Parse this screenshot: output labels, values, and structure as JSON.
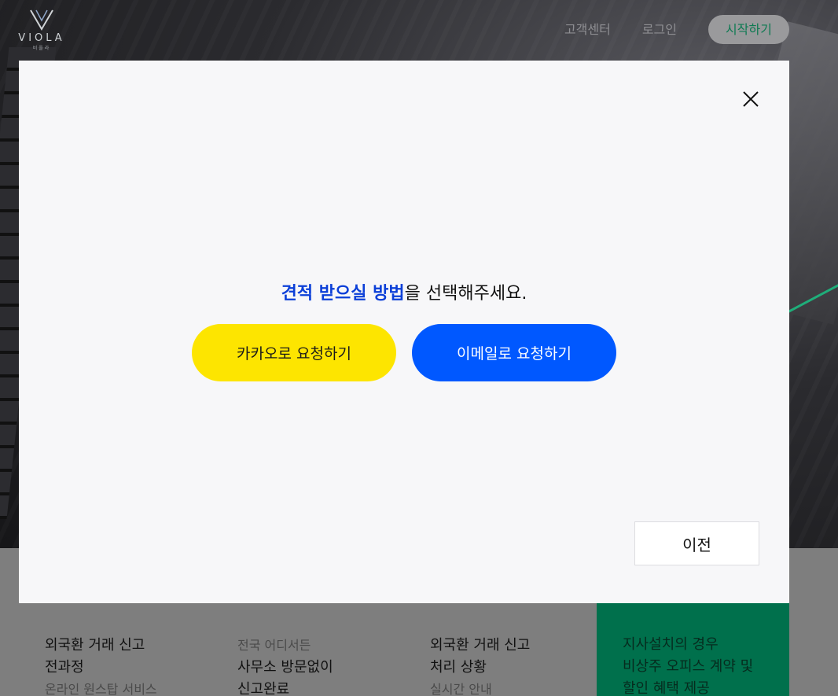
{
  "header": {
    "logo_text": "VIOLA",
    "logo_sub": "비올라",
    "nav": {
      "support": "고객센터",
      "login": "로그인",
      "start": "시작하기"
    }
  },
  "features": [
    {
      "line1": "외국환 거래 신고",
      "line2": "전과정",
      "sub": "온라인 원스탑 서비스"
    },
    {
      "sub_top": "전국 어디서든",
      "line1": "사무소 방문없이",
      "line2": "신고완료"
    },
    {
      "line1": "외국환 거래 신고",
      "line2": "처리 상황",
      "sub": "실시간 안내"
    },
    {
      "line1": "지사설치의 경우",
      "line2": "비상주 오피스 계약 및",
      "line3": "할인 혜택 제공"
    }
  ],
  "modal": {
    "prompt_highlight": "견적 받으실 방법",
    "prompt_rest": "을 선택해주세요.",
    "kakao_button": "카카오로 요청하기",
    "email_button": "이메일로 요청하기",
    "prev_button": "이전",
    "close_icon": "close-icon"
  },
  "colors": {
    "kakao": "#fde500",
    "email": "#0058ff",
    "highlight": "#0b3fd8",
    "green": "#00704c"
  }
}
